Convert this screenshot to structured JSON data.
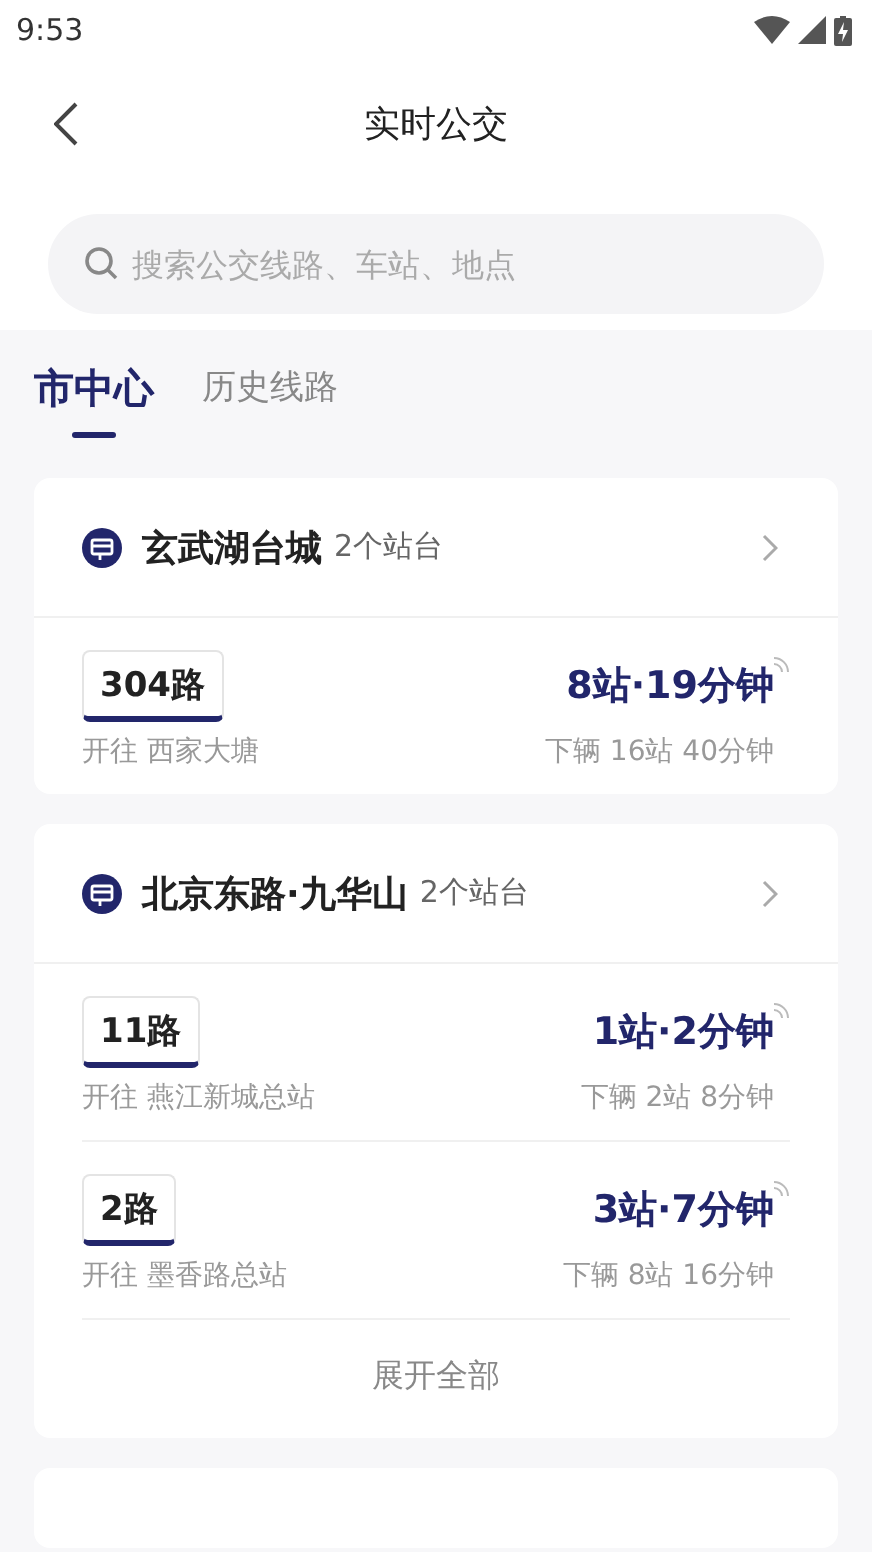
{
  "status_bar": {
    "time": "9:53"
  },
  "header": {
    "title": "实时公交"
  },
  "search": {
    "placeholder": "搜索公交线路、车站、地点"
  },
  "tabs": [
    {
      "label": "市中心",
      "selected": true
    },
    {
      "label": "历史线路",
      "selected": false
    }
  ],
  "stations": [
    {
      "name": "玄武湖台城",
      "platforms": "2个站台",
      "routes": [
        {
          "route": "304路",
          "direction": "开往 西家大塘",
          "eta": "8站·19分钟",
          "next": "下辆 16站 40分钟"
        }
      ]
    },
    {
      "name": "北京东路·九华山",
      "platforms": "2个站台",
      "routes": [
        {
          "route": "11路",
          "direction": "开往 燕江新城总站",
          "eta": "1站·2分钟",
          "next": "下辆 2站 8分钟"
        },
        {
          "route": "2路",
          "direction": "开往 墨香路总站",
          "eta": "3站·7分钟",
          "next": "下辆 8站 16分钟"
        }
      ],
      "expand": "展开全部"
    }
  ]
}
